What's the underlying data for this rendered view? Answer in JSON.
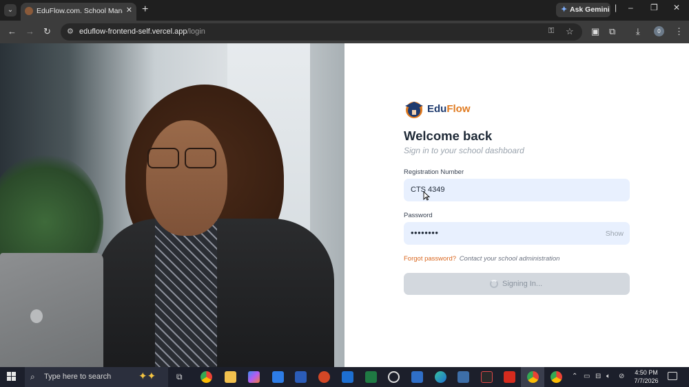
{
  "browser": {
    "tab_title": "EduFlow.com. School Managem",
    "tab_close": "✕",
    "new_tab": "+",
    "ask_gemini": "Ask Gemini",
    "url_host": "eduflow-frontend-self.vercel.app",
    "url_path": "/login",
    "profile_initial": "0",
    "icons": [
      "tab-menu-icon",
      "back-icon",
      "forward-icon",
      "reload-icon",
      "site-info-icon",
      "password-key-icon",
      "bookmark-star-icon",
      "extension-icon",
      "download-icon",
      "more-icon"
    ]
  },
  "login": {
    "brand": {
      "prefix": "Edu",
      "suffix": "Flow"
    },
    "heading": "Welcome back",
    "subtitle": "Sign in to your school dashboard",
    "registration_label": "Registration Number",
    "registration_value": "CTS 4349",
    "password_label": "Password",
    "password_mask": "••••••••",
    "show_label": "Show",
    "forgot_link": "Forgot password?",
    "forgot_note": "Contact your school administration",
    "submit_label": "Signing In...",
    "colors": {
      "brand_navy": "#1e3a6e",
      "brand_orange": "#e07a1f",
      "field_bg": "#e8f0fe"
    }
  },
  "taskbar": {
    "search_placeholder": "Type here to search",
    "time": "4:50 PM",
    "date": "7/7/2026"
  }
}
